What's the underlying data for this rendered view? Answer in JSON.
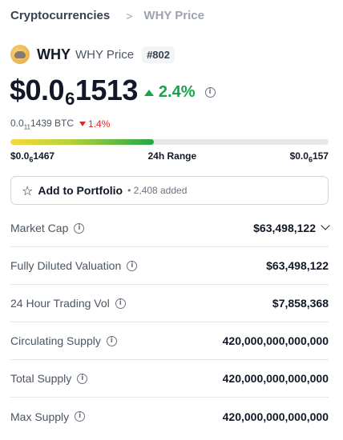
{
  "breadcrumb": {
    "parent": "Cryptocurrencies",
    "separator": ">",
    "current": "WHY Price"
  },
  "coin": {
    "symbol": "WHY",
    "name": "WHY Price",
    "rank": "#802",
    "logo_icon": "why-coin-logo-icon"
  },
  "price": {
    "prefix": "$0.0",
    "zero_count": "6",
    "digits": "1513",
    "change": "2.4%",
    "change_direction": "up"
  },
  "btc": {
    "prefix": "0.0",
    "zero_count": "11",
    "digits": "1439 BTC",
    "change": "1.4%",
    "change_direction": "down"
  },
  "range": {
    "low_prefix": "$0.0",
    "low_zero_count": "6",
    "low_digits": "1467",
    "label": "24h Range",
    "high_prefix": "$0.0",
    "high_zero_count": "6",
    "high_digits": "157",
    "position_fraction": 0.45
  },
  "portfolio": {
    "label": "Add to Portfolio",
    "count": "• 2,408 added"
  },
  "stats": [
    {
      "label": "Market Cap",
      "value": "$63,498,122"
    },
    {
      "label": "Fully Diluted Valuation",
      "value": "$63,498,122"
    },
    {
      "label": "24 Hour Trading Vol",
      "value": "$7,858,368"
    },
    {
      "label": "Circulating Supply",
      "value": "420,000,000,000,000"
    },
    {
      "label": "Total Supply",
      "value": "420,000,000,000,000"
    },
    {
      "label": "Max Supply",
      "value": "420,000,000,000,000"
    }
  ],
  "colors": {
    "positive": "#16a34a",
    "negative": "#dc2626"
  }
}
